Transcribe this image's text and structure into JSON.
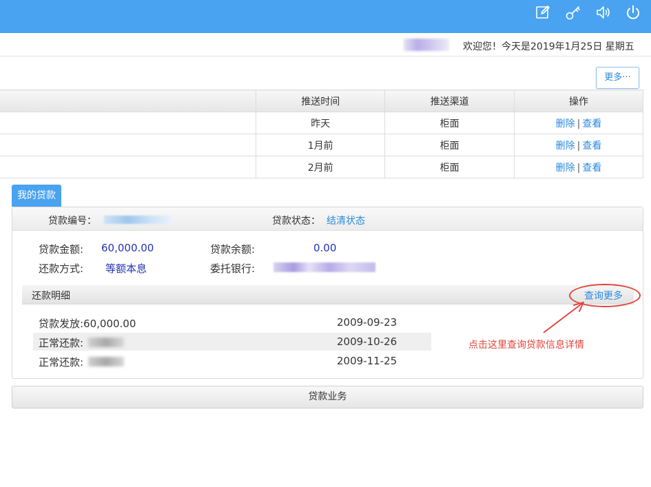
{
  "header": {
    "icons": [
      "edit-icon",
      "key-icon",
      "speaker-icon",
      "power-icon"
    ],
    "background_color": "#4aa3f0"
  },
  "welcome": {
    "text": "欢迎您！今天是2019年1月25日 星期五"
  },
  "more_button": "更多···",
  "push_table": {
    "columns": [
      "",
      "推送时间",
      "推送渠道",
      "操作"
    ],
    "rows": [
      {
        "time": "昨天",
        "channel": "柜面"
      },
      {
        "time": "1月前",
        "channel": "柜面"
      },
      {
        "time": "2月前",
        "channel": "柜面"
      }
    ],
    "delete_label": "删除",
    "separator": "|",
    "view_label": "查看"
  },
  "my_loan": {
    "tab_label": "我的贷款",
    "loan_no_label": "贷款编号：",
    "status_label": "贷款状态：",
    "status_value": "结清状态",
    "amount_label": "贷款金额:",
    "amount_value": "60,000.00",
    "balance_label": "贷款余额:",
    "balance_value": "0.00",
    "method_label": "还款方式:",
    "method_value": "等额本息",
    "bank_label": "委托银行:",
    "detail_title": "还款明细",
    "query_more": "查询更多",
    "records": [
      {
        "label": "贷款发放:60,000.00",
        "date": "2009-09-23"
      },
      {
        "label": "正常还款:",
        "date": "2009-10-26"
      },
      {
        "label": "正常还款:",
        "date": "2009-11-25"
      }
    ]
  },
  "annotation": {
    "text": "点击这里查询贷款信息详情",
    "color": "#e2453b"
  },
  "business_button": "贷款业务"
}
